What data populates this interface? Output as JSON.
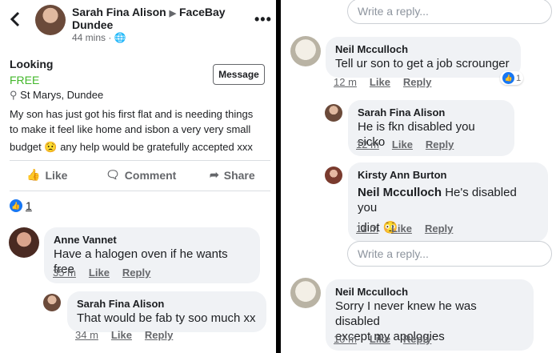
{
  "post": {
    "author": "Sarah Fina Alison",
    "group": "FaceBay",
    "group_line2": "Dundee",
    "time": "44 mins",
    "title": "Looking",
    "price": "FREE",
    "location": "St Marys, Dundee",
    "message_label": "Message",
    "body_line1": "My son has just got his first flat and is needing things",
    "body_line2": "to make it feel like home and isbon a very very small",
    "body_line3_a": "budget",
    "body_line3_b": "any help would be gratefully accepted xxx",
    "like_label": "Like",
    "comment_label": "Comment",
    "share_label": "Share",
    "reaction_count": "1"
  },
  "comments_left": [
    {
      "name": "Anne Vannet",
      "text": "Have a halogen oven if he wants free",
      "time": "35 m",
      "like": "Like",
      "reply": "Reply"
    },
    {
      "name": "Sarah Fina Alison",
      "text": "That would be fab ty soo much xx",
      "time": "34 m",
      "like": "Like",
      "reply": "Reply"
    }
  ],
  "right": {
    "reply_placeholder": "Write a reply...",
    "comments": [
      {
        "name": "Neil Mcculloch",
        "text": "Tell ur son to get a job scrounger",
        "time": "12 m",
        "like": "Like",
        "reply": "Reply",
        "reactions": "1"
      },
      {
        "name": "Sarah Fina Alison",
        "text": "He is fkn disabled you sicko",
        "time": "12 m",
        "like": "Like",
        "reply": "Reply"
      },
      {
        "name": "Kirsty Ann Burton",
        "mention": "Neil Mcculloch",
        "text": "He's disabled you",
        "text2": "idiot",
        "time": "11 m",
        "like": "Like",
        "reply": "Reply"
      },
      {
        "name": "Neil Mcculloch",
        "text": "Sorry I never knew he was disabled",
        "text2": "except my apologies",
        "time": "10 m",
        "like": "Like",
        "reply": "Reply"
      }
    ]
  }
}
